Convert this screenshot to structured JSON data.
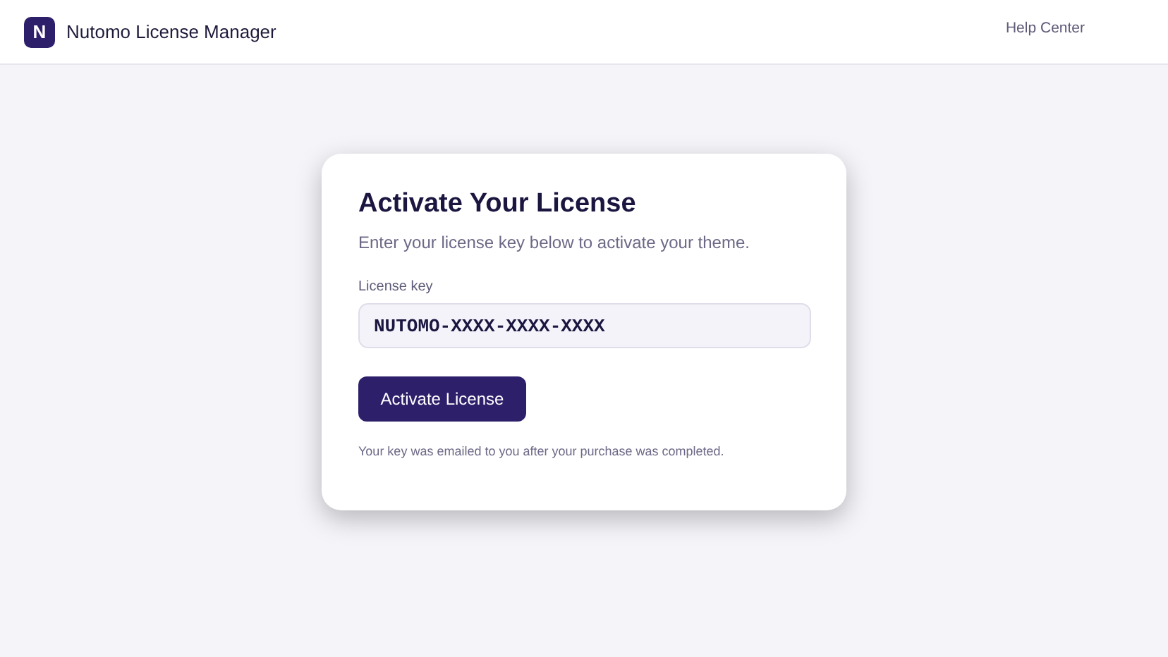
{
  "header": {
    "logo_letter": "N",
    "title": "Nutomo License Manager",
    "help_link": "Help Center"
  },
  "card": {
    "title": "Activate Your License",
    "subtitle": "Enter your license key below to activate your theme.",
    "field_label": "License key",
    "field_value": "NUTOMO-XXXX-XXXX-XXXX",
    "button": "Activate License",
    "note": "Your key was emailed to you after your purchase was completed."
  }
}
